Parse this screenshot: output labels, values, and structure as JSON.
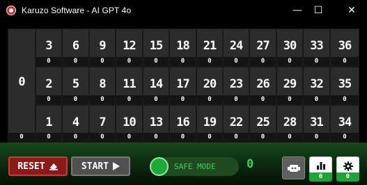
{
  "window": {
    "title": "Karuzo Software - AI GPT 4o",
    "minimize": "—",
    "maximize": "☐",
    "close": "✕"
  },
  "board": {
    "zero": {
      "number": "0",
      "count": "0"
    },
    "rows": [
      [
        {
          "number": "3",
          "count": "0"
        },
        {
          "number": "6",
          "count": "0"
        },
        {
          "number": "9",
          "count": "0"
        },
        {
          "number": "12",
          "count": "0"
        },
        {
          "number": "15",
          "count": "0"
        },
        {
          "number": "18",
          "count": "0"
        },
        {
          "number": "21",
          "count": "0"
        },
        {
          "number": "24",
          "count": "0"
        },
        {
          "number": "27",
          "count": "0"
        },
        {
          "number": "30",
          "count": "0"
        },
        {
          "number": "33",
          "count": "0"
        },
        {
          "number": "36",
          "count": "0"
        }
      ],
      [
        {
          "number": "2",
          "count": "0"
        },
        {
          "number": "5",
          "count": "0"
        },
        {
          "number": "8",
          "count": "0"
        },
        {
          "number": "11",
          "count": "0"
        },
        {
          "number": "14",
          "count": "0"
        },
        {
          "number": "17",
          "count": "0"
        },
        {
          "number": "20",
          "count": "0"
        },
        {
          "number": "23",
          "count": "0"
        },
        {
          "number": "26",
          "count": "0"
        },
        {
          "number": "29",
          "count": "0"
        },
        {
          "number": "32",
          "count": "0"
        },
        {
          "number": "35",
          "count": "0"
        }
      ],
      [
        {
          "number": "1",
          "count": "0"
        },
        {
          "number": "4",
          "count": "0"
        },
        {
          "number": "7",
          "count": "0"
        },
        {
          "number": "10",
          "count": "0"
        },
        {
          "number": "13",
          "count": "0"
        },
        {
          "number": "16",
          "count": "0"
        },
        {
          "number": "19",
          "count": "0"
        },
        {
          "number": "22",
          "count": "0"
        },
        {
          "number": "25",
          "count": "0"
        },
        {
          "number": "28",
          "count": "0"
        },
        {
          "number": "31",
          "count": "0"
        },
        {
          "number": "34",
          "count": "0"
        }
      ]
    ]
  },
  "controls": {
    "reset_label": "RESET",
    "start_label": "START",
    "safe_mode_label": "SAFE MODE",
    "safe_mode_count": "0",
    "bot_icon": "robot-icon",
    "stats_icon": "bar-chart-icon",
    "stats_count": "0",
    "settings_icon": "gear-icon",
    "settings_count": "0"
  },
  "colors": {
    "reset": "#8b1a1a",
    "accent_green": "#3fd05a",
    "badge_green": "#22a03a"
  }
}
